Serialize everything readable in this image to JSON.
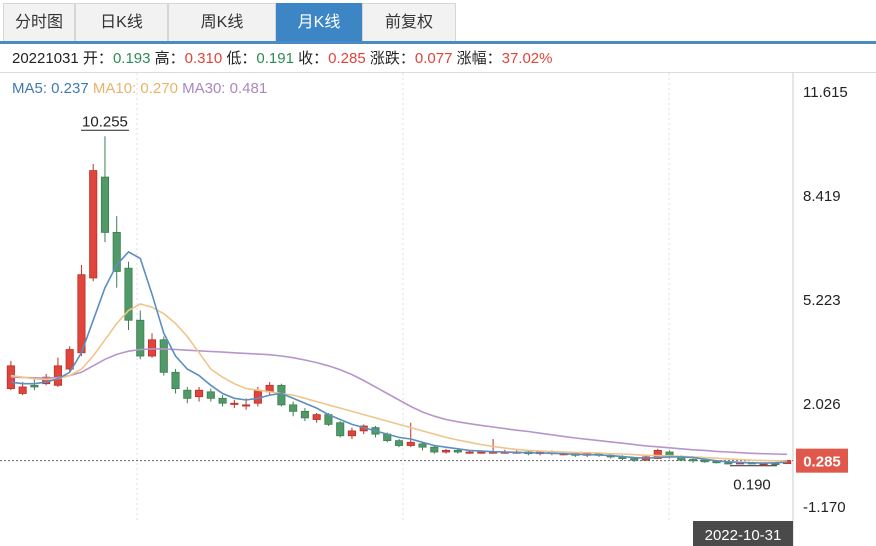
{
  "tabs": [
    "分时图",
    "日K线",
    "周K线",
    "月K线",
    "前复权"
  ],
  "active_tab": 3,
  "info": {
    "date": "20221031",
    "open_label": "开：",
    "open": "0.193",
    "high_label": "高：",
    "high": "0.310",
    "low_label": "低：",
    "low": "0.191",
    "close_label": "收：",
    "close": "0.285",
    "change_label": "涨跌：",
    "change": "0.077",
    "pct_label": "涨幅：",
    "pct": "37.02%"
  },
  "ma": {
    "ma5": "MA5: 0.237",
    "ma10": "MA10: 0.270",
    "ma30": "MA30: 0.481"
  },
  "colors": {
    "up": "#e0443a",
    "down": "#4f9a66",
    "ma5": "#5b8fc0",
    "ma10": "#efc58b",
    "ma30": "#b795cc",
    "accent": "#3d86c6",
    "price_tag": "#e0574c",
    "date_tag": "#4a4a4a"
  },
  "chart_data": {
    "type": "candlestick",
    "y_ticks": [
      "11.615",
      "8.419",
      "5.223",
      "2.026",
      "-1.170"
    ],
    "y_tick_values": [
      11.615,
      8.419,
      5.223,
      2.026,
      -1.17
    ],
    "ylim": [
      -1.17,
      11.615
    ],
    "current_price": "0.285",
    "current_price_value": 0.285,
    "max_label": "10.255",
    "min_label": "0.190",
    "crosshair_date": "2022-10-31",
    "candles": [
      [
        2.5,
        3.2,
        3.35,
        2.45
      ],
      [
        2.35,
        2.55,
        2.7,
        2.3
      ],
      [
        2.6,
        2.55,
        2.8,
        2.45
      ],
      [
        2.65,
        2.85,
        2.95,
        2.6
      ],
      [
        2.6,
        3.2,
        3.45,
        2.55
      ],
      [
        3.1,
        3.7,
        3.8,
        3.0
      ],
      [
        3.6,
        6.0,
        6.3,
        3.5
      ],
      [
        5.9,
        9.2,
        9.4,
        5.8
      ],
      [
        9.0,
        7.3,
        10.255,
        7.0
      ],
      [
        7.3,
        6.1,
        7.8,
        5.6
      ],
      [
        6.2,
        4.6,
        6.4,
        4.3
      ],
      [
        4.6,
        3.5,
        4.9,
        3.4
      ],
      [
        3.5,
        4.0,
        4.2,
        3.45
      ],
      [
        4.0,
        3.0,
        4.1,
        2.9
      ],
      [
        3.0,
        2.5,
        3.1,
        2.35
      ],
      [
        2.45,
        2.2,
        2.55,
        2.05
      ],
      [
        2.25,
        2.45,
        2.55,
        2.1
      ],
      [
        2.4,
        2.2,
        2.5,
        2.1
      ],
      [
        2.2,
        2.05,
        2.3,
        1.95
      ],
      [
        2.05,
        2.05,
        2.15,
        1.9
      ],
      [
        2.0,
        2.0,
        2.2,
        1.85
      ],
      [
        2.05,
        2.45,
        2.55,
        1.95
      ],
      [
        2.4,
        2.6,
        2.7,
        2.3
      ],
      [
        2.6,
        2.0,
        2.65,
        1.95
      ],
      [
        2.0,
        1.8,
        2.1,
        1.65
      ],
      [
        1.8,
        1.6,
        1.9,
        1.5
      ],
      [
        1.55,
        1.7,
        1.75,
        1.45
      ],
      [
        1.7,
        1.4,
        1.75,
        1.35
      ],
      [
        1.45,
        1.05,
        1.5,
        1.0
      ],
      [
        1.05,
        1.2,
        1.3,
        0.95
      ],
      [
        1.2,
        1.35,
        1.4,
        1.1
      ],
      [
        1.3,
        1.1,
        1.35,
        1.0
      ],
      [
        1.1,
        0.9,
        1.15,
        0.85
      ],
      [
        0.9,
        0.75,
        0.95,
        0.7
      ],
      [
        0.75,
        0.85,
        1.45,
        0.7
      ],
      [
        0.8,
        0.7,
        0.85,
        0.6
      ],
      [
        0.7,
        0.55,
        0.75,
        0.5
      ],
      [
        0.55,
        0.6,
        0.65,
        0.5
      ],
      [
        0.6,
        0.55,
        0.65,
        0.5
      ],
      [
        0.55,
        0.55,
        0.6,
        0.5
      ],
      [
        0.55,
        0.55,
        0.6,
        0.5
      ],
      [
        0.55,
        0.55,
        0.95,
        0.5
      ],
      [
        0.55,
        0.55,
        0.62,
        0.5
      ],
      [
        0.55,
        0.55,
        0.6,
        0.5
      ],
      [
        0.55,
        0.5,
        0.6,
        0.45
      ],
      [
        0.5,
        0.55,
        0.6,
        0.45
      ],
      [
        0.55,
        0.5,
        0.6,
        0.45
      ],
      [
        0.5,
        0.5,
        0.55,
        0.45
      ],
      [
        0.5,
        0.45,
        0.55,
        0.4
      ],
      [
        0.45,
        0.5,
        0.55,
        0.4
      ],
      [
        0.5,
        0.45,
        0.52,
        0.4
      ],
      [
        0.45,
        0.4,
        0.5,
        0.35
      ],
      [
        0.4,
        0.35,
        0.45,
        0.3
      ],
      [
        0.35,
        0.3,
        0.38,
        0.25
      ],
      [
        0.3,
        0.4,
        0.45,
        0.28
      ],
      [
        0.35,
        0.6,
        0.65,
        0.33
      ],
      [
        0.55,
        0.4,
        0.6,
        0.35
      ],
      [
        0.4,
        0.3,
        0.45,
        0.28
      ],
      [
        0.32,
        0.28,
        0.35,
        0.22
      ],
      [
        0.3,
        0.25,
        0.32,
        0.22
      ],
      [
        0.26,
        0.22,
        0.28,
        0.2
      ],
      [
        0.22,
        0.2,
        0.25,
        0.19
      ],
      [
        0.21,
        0.22,
        0.24,
        0.19
      ],
      [
        0.22,
        0.2,
        0.24,
        0.19
      ],
      [
        0.2,
        0.2,
        0.23,
        0.19
      ],
      [
        0.2,
        0.193,
        0.22,
        0.19
      ],
      [
        0.193,
        0.285,
        0.31,
        0.191
      ]
    ],
    "ma5": [
      2.7,
      2.65,
      2.65,
      2.7,
      2.8,
      3.0,
      3.6,
      4.6,
      5.6,
      6.3,
      6.7,
      6.5,
      5.4,
      4.2,
      3.5,
      3.1,
      2.9,
      2.6,
      2.35,
      2.2,
      2.15,
      2.2,
      2.3,
      2.35,
      2.2,
      2.05,
      1.9,
      1.7,
      1.55,
      1.4,
      1.3,
      1.2,
      1.1,
      1.0,
      0.95,
      0.85,
      0.75,
      0.7,
      0.65,
      0.6,
      0.58,
      0.56,
      0.55,
      0.54,
      0.53,
      0.52,
      0.51,
      0.5,
      0.48,
      0.47,
      0.46,
      0.44,
      0.41,
      0.38,
      0.36,
      0.38,
      0.4,
      0.4,
      0.38,
      0.33,
      0.28,
      0.25,
      0.23,
      0.22,
      0.21,
      0.22,
      0.237
    ],
    "ma10": [
      2.9,
      2.85,
      2.8,
      2.78,
      2.8,
      2.9,
      3.1,
      3.5,
      4.0,
      4.5,
      4.9,
      5.1,
      5.0,
      4.8,
      4.5,
      4.1,
      3.6,
      3.1,
      2.85,
      2.65,
      2.5,
      2.45,
      2.4,
      2.35,
      2.3,
      2.2,
      2.1,
      2.0,
      1.9,
      1.8,
      1.7,
      1.6,
      1.5,
      1.4,
      1.3,
      1.2,
      1.1,
      1.0,
      0.92,
      0.85,
      0.78,
      0.72,
      0.67,
      0.63,
      0.6,
      0.58,
      0.56,
      0.55,
      0.54,
      0.53,
      0.52,
      0.5,
      0.49,
      0.47,
      0.45,
      0.44,
      0.43,
      0.42,
      0.4,
      0.38,
      0.36,
      0.34,
      0.32,
      0.3,
      0.29,
      0.28,
      0.27
    ],
    "ma30": [
      2.85,
      2.84,
      2.83,
      2.82,
      2.84,
      2.9,
      3.0,
      3.2,
      3.4,
      3.55,
      3.65,
      3.7,
      3.72,
      3.72,
      3.7,
      3.68,
      3.66,
      3.64,
      3.62,
      3.6,
      3.58,
      3.56,
      3.54,
      3.5,
      3.45,
      3.38,
      3.3,
      3.2,
      3.08,
      2.93,
      2.75,
      2.55,
      2.35,
      2.15,
      1.95,
      1.78,
      1.65,
      1.55,
      1.48,
      1.42,
      1.37,
      1.32,
      1.27,
      1.22,
      1.18,
      1.13,
      1.08,
      1.03,
      0.98,
      0.94,
      0.9,
      0.86,
      0.82,
      0.78,
      0.74,
      0.71,
      0.68,
      0.65,
      0.62,
      0.6,
      0.57,
      0.55,
      0.53,
      0.51,
      0.5,
      0.49,
      0.481
    ]
  }
}
